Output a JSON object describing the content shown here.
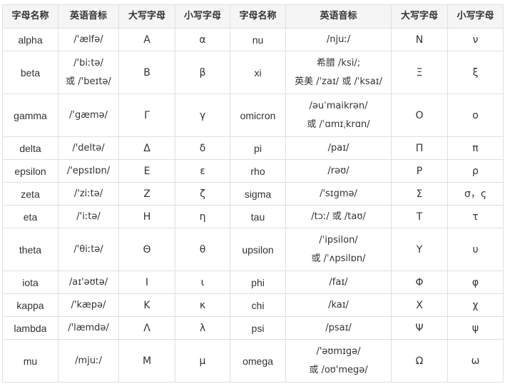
{
  "headers": [
    "字母名称",
    "英语音标",
    "大写字母",
    "小写字母",
    "字母名称",
    "英语音标",
    "大写字母",
    "小写字母"
  ],
  "rows": [
    {
      "left": {
        "name": "alpha",
        "ipa": [
          "/'ælfə/"
        ],
        "upper": "Α",
        "lower": "α"
      },
      "right": {
        "name": "nu",
        "ipa": [
          "/njuː/"
        ],
        "upper": "Ν",
        "lower": "ν"
      }
    },
    {
      "left": {
        "name": "beta",
        "ipa": [
          "/'biːtə/",
          "或 /'beɪtə/"
        ],
        "upper": "Β",
        "lower": "β"
      },
      "right": {
        "name": "xi",
        "ipa": [
          "希腊 /ksi/;",
          "英美 /ˈzaɪ/ 或 /ˈksaɪ/"
        ],
        "upper": "Ξ",
        "lower": "ξ"
      }
    },
    {
      "left": {
        "name": "gamma",
        "ipa": [
          "/'gæmə/"
        ],
        "upper": "Γ",
        "lower": "γ"
      },
      "right": {
        "name": "omicron",
        "ipa": [
          "/əuˈmaikrən/",
          "或 /ˈɑmɪˌkrɑn/"
        ],
        "upper": "Ο",
        "lower": "ο"
      }
    },
    {
      "left": {
        "name": "delta",
        "ipa": [
          "/'deltə/"
        ],
        "upper": "Δ",
        "lower": "δ"
      },
      "right": {
        "name": "pi",
        "ipa": [
          "/paɪ/"
        ],
        "upper": "Π",
        "lower": "π"
      }
    },
    {
      "left": {
        "name": "epsilon",
        "ipa": [
          "/'epsɪlɒn/"
        ],
        "upper": "Ε",
        "lower": "ε"
      },
      "right": {
        "name": "rho",
        "ipa": [
          "/rəʊ/"
        ],
        "upper": "Ρ",
        "lower": "ρ"
      }
    },
    {
      "left": {
        "name": "zeta",
        "ipa": [
          "/'ziːtə/"
        ],
        "upper": "Ζ",
        "lower": "ζ"
      },
      "right": {
        "name": "sigma",
        "ipa": [
          "/'sɪgmə/"
        ],
        "upper": "Σ",
        "lower": "σ，ς"
      }
    },
    {
      "left": {
        "name": "eta",
        "ipa": [
          "/'iːtə/"
        ],
        "upper": "Η",
        "lower": "η"
      },
      "right": {
        "name": "tau",
        "ipa": [
          "/tɔː/ 或 /taʊ/"
        ],
        "upper": "Τ",
        "lower": "τ"
      }
    },
    {
      "left": {
        "name": "theta",
        "ipa": [
          "/'θiːtə/"
        ],
        "upper": "Θ",
        "lower": "θ"
      },
      "right": {
        "name": "upsilon",
        "ipa": [
          "/ˈipsilon/",
          "或 /ˈʌpsilɒn/"
        ],
        "upper": "Υ",
        "lower": "υ"
      }
    },
    {
      "left": {
        "name": "iota",
        "ipa": [
          "/aɪ'əʊtə/"
        ],
        "upper": "Ι",
        "lower": "ι"
      },
      "right": {
        "name": "phi",
        "ipa": [
          "/faɪ/"
        ],
        "upper": "Φ",
        "lower": "φ"
      }
    },
    {
      "left": {
        "name": "kappa",
        "ipa": [
          "/'kæpə/"
        ],
        "upper": "Κ",
        "lower": "κ"
      },
      "right": {
        "name": "chi",
        "ipa": [
          "/kaɪ/"
        ],
        "upper": "Χ",
        "lower": "χ"
      }
    },
    {
      "left": {
        "name": "lambda",
        "ipa": [
          "/'læmdə/"
        ],
        "upper": "Λ",
        "lower": "λ"
      },
      "right": {
        "name": "psi",
        "ipa": [
          "/psaɪ/"
        ],
        "upper": "Ψ",
        "lower": "ψ"
      }
    },
    {
      "left": {
        "name": "mu",
        "ipa": [
          "/mjuː/"
        ],
        "upper": "Μ",
        "lower": "μ"
      },
      "right": {
        "name": "omega",
        "ipa": [
          "/'əʊmɪgə/",
          "或 /oʊ'megə/"
        ],
        "upper": "Ω",
        "lower": "ω"
      }
    }
  ]
}
